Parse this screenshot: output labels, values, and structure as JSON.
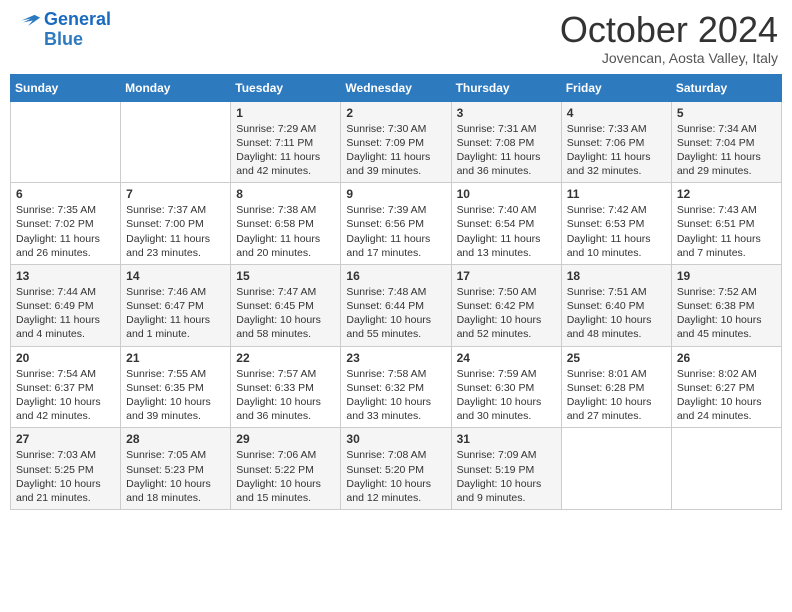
{
  "header": {
    "logo": {
      "line1": "General",
      "line2": "Blue"
    },
    "title": "October 2024",
    "subtitle": "Jovencan, Aosta Valley, Italy"
  },
  "weekdays": [
    "Sunday",
    "Monday",
    "Tuesday",
    "Wednesday",
    "Thursday",
    "Friday",
    "Saturday"
  ],
  "weeks": [
    [
      {
        "day": "",
        "info": ""
      },
      {
        "day": "",
        "info": ""
      },
      {
        "day": "1",
        "info": "Sunrise: 7:29 AM\nSunset: 7:11 PM\nDaylight: 11 hours and 42 minutes."
      },
      {
        "day": "2",
        "info": "Sunrise: 7:30 AM\nSunset: 7:09 PM\nDaylight: 11 hours and 39 minutes."
      },
      {
        "day": "3",
        "info": "Sunrise: 7:31 AM\nSunset: 7:08 PM\nDaylight: 11 hours and 36 minutes."
      },
      {
        "day": "4",
        "info": "Sunrise: 7:33 AM\nSunset: 7:06 PM\nDaylight: 11 hours and 32 minutes."
      },
      {
        "day": "5",
        "info": "Sunrise: 7:34 AM\nSunset: 7:04 PM\nDaylight: 11 hours and 29 minutes."
      }
    ],
    [
      {
        "day": "6",
        "info": "Sunrise: 7:35 AM\nSunset: 7:02 PM\nDaylight: 11 hours and 26 minutes."
      },
      {
        "day": "7",
        "info": "Sunrise: 7:37 AM\nSunset: 7:00 PM\nDaylight: 11 hours and 23 minutes."
      },
      {
        "day": "8",
        "info": "Sunrise: 7:38 AM\nSunset: 6:58 PM\nDaylight: 11 hours and 20 minutes."
      },
      {
        "day": "9",
        "info": "Sunrise: 7:39 AM\nSunset: 6:56 PM\nDaylight: 11 hours and 17 minutes."
      },
      {
        "day": "10",
        "info": "Sunrise: 7:40 AM\nSunset: 6:54 PM\nDaylight: 11 hours and 13 minutes."
      },
      {
        "day": "11",
        "info": "Sunrise: 7:42 AM\nSunset: 6:53 PM\nDaylight: 11 hours and 10 minutes."
      },
      {
        "day": "12",
        "info": "Sunrise: 7:43 AM\nSunset: 6:51 PM\nDaylight: 11 hours and 7 minutes."
      }
    ],
    [
      {
        "day": "13",
        "info": "Sunrise: 7:44 AM\nSunset: 6:49 PM\nDaylight: 11 hours and 4 minutes."
      },
      {
        "day": "14",
        "info": "Sunrise: 7:46 AM\nSunset: 6:47 PM\nDaylight: 11 hours and 1 minute."
      },
      {
        "day": "15",
        "info": "Sunrise: 7:47 AM\nSunset: 6:45 PM\nDaylight: 10 hours and 58 minutes."
      },
      {
        "day": "16",
        "info": "Sunrise: 7:48 AM\nSunset: 6:44 PM\nDaylight: 10 hours and 55 minutes."
      },
      {
        "day": "17",
        "info": "Sunrise: 7:50 AM\nSunset: 6:42 PM\nDaylight: 10 hours and 52 minutes."
      },
      {
        "day": "18",
        "info": "Sunrise: 7:51 AM\nSunset: 6:40 PM\nDaylight: 10 hours and 48 minutes."
      },
      {
        "day": "19",
        "info": "Sunrise: 7:52 AM\nSunset: 6:38 PM\nDaylight: 10 hours and 45 minutes."
      }
    ],
    [
      {
        "day": "20",
        "info": "Sunrise: 7:54 AM\nSunset: 6:37 PM\nDaylight: 10 hours and 42 minutes."
      },
      {
        "day": "21",
        "info": "Sunrise: 7:55 AM\nSunset: 6:35 PM\nDaylight: 10 hours and 39 minutes."
      },
      {
        "day": "22",
        "info": "Sunrise: 7:57 AM\nSunset: 6:33 PM\nDaylight: 10 hours and 36 minutes."
      },
      {
        "day": "23",
        "info": "Sunrise: 7:58 AM\nSunset: 6:32 PM\nDaylight: 10 hours and 33 minutes."
      },
      {
        "day": "24",
        "info": "Sunrise: 7:59 AM\nSunset: 6:30 PM\nDaylight: 10 hours and 30 minutes."
      },
      {
        "day": "25",
        "info": "Sunrise: 8:01 AM\nSunset: 6:28 PM\nDaylight: 10 hours and 27 minutes."
      },
      {
        "day": "26",
        "info": "Sunrise: 8:02 AM\nSunset: 6:27 PM\nDaylight: 10 hours and 24 minutes."
      }
    ],
    [
      {
        "day": "27",
        "info": "Sunrise: 7:03 AM\nSunset: 5:25 PM\nDaylight: 10 hours and 21 minutes."
      },
      {
        "day": "28",
        "info": "Sunrise: 7:05 AM\nSunset: 5:23 PM\nDaylight: 10 hours and 18 minutes."
      },
      {
        "day": "29",
        "info": "Sunrise: 7:06 AM\nSunset: 5:22 PM\nDaylight: 10 hours and 15 minutes."
      },
      {
        "day": "30",
        "info": "Sunrise: 7:08 AM\nSunset: 5:20 PM\nDaylight: 10 hours and 12 minutes."
      },
      {
        "day": "31",
        "info": "Sunrise: 7:09 AM\nSunset: 5:19 PM\nDaylight: 10 hours and 9 minutes."
      },
      {
        "day": "",
        "info": ""
      },
      {
        "day": "",
        "info": ""
      }
    ]
  ]
}
